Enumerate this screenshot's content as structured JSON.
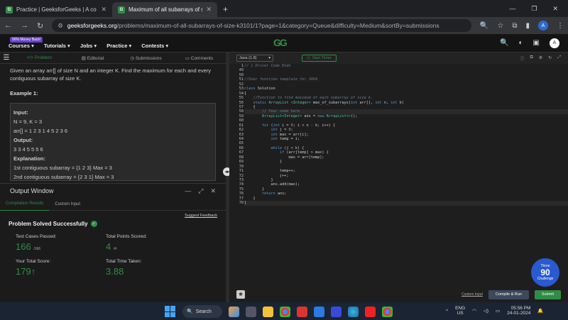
{
  "browser": {
    "tabs": [
      {
        "title": "Practice | GeeksforGeeks | A co"
      },
      {
        "title": "Maximum of all subarrays of siz"
      }
    ],
    "new_tab": "+",
    "window_controls": [
      "—",
      "❐",
      "✕"
    ],
    "url_host": "geeksforgeeks.org",
    "url_path": "/problems/maximum-of-all-subarrays-of-size-k3101/1?page=1&category=Queue&difficulty=Medium&sortBy=submissions",
    "profile_initial": "A"
  },
  "site": {
    "badge": "90% Money Back!",
    "menu": [
      "Courses ▾",
      "Tutorials ▾",
      "Jobs ▾",
      "Practice ▾",
      "Contests ▾"
    ],
    "logo": "GG",
    "profile_initial": "A"
  },
  "problem_tabs": [
    "Problem",
    "Editorial",
    "Submissions",
    "Comments"
  ],
  "problem": {
    "statement": "Given an array arr[] of size N and an integer K. Find the maximum for each and every contiguous subarray of size K.",
    "example_heading": "Example 1:",
    "example_lines": [
      {
        "t": "Input:",
        "bold": true
      },
      {
        "t": "N = 9, K = 3",
        "bold": false
      },
      {
        "t": "arr[] = 1 2 3 1 4 5 2 3 6",
        "bold": false
      },
      {
        "t": "Output:",
        "bold": true
      },
      {
        "t": "3 3 4 5 5 5 6",
        "bold": false
      },
      {
        "t": "Explanation:",
        "bold": true
      },
      {
        "t": "1st contiguous subarray = {1 2 3} Max = 3",
        "bold": false
      },
      {
        "t": "2nd contiguous subarray = {2 3 1} Max = 3",
        "bold": false
      }
    ]
  },
  "output_window": {
    "title": "Output Window",
    "controls": [
      "—",
      "⤢",
      "✕"
    ],
    "tabs": [
      "Compilation Results",
      "Custom Input"
    ],
    "suggest": "Suggest Feedback",
    "status": "Problem Solved Successfully",
    "stats": [
      {
        "label": "Test Cases Passed:",
        "value": "166",
        "sub": "/166"
      },
      {
        "label": "Total Points Scored:",
        "value": "4",
        "sub": "/4"
      },
      {
        "label": "Your Total Score:",
        "value": "179↑",
        "sub": ""
      },
      {
        "label": "Total Time Taken:",
        "value": "3.88",
        "sub": ""
      }
    ]
  },
  "editor": {
    "language": "Java (1.8)",
    "timer": "Start Timer",
    "bottom": {
      "custom_input": "Custom Input",
      "compile": "Compile & Run",
      "submit": "Submit"
    }
  },
  "code_lines": [
    {
      "n": "1",
      "html": "<span class='cm'>// } Driver Code Ends</span>"
    },
    {
      "n": "49",
      "html": ""
    },
    {
      "n": "50",
      "html": ""
    },
    {
      "n": "51",
      "html": "<span class='cm'>//User function template for JAVA</span>"
    },
    {
      "n": "52",
      "html": ""
    },
    {
      "n": "53",
      "html": "<span class='kw'>class</span> <span class='pl'>Solution</span>"
    },
    {
      "n": "54",
      "html": "<span class='op'>{</span>"
    },
    {
      "n": "55",
      "html": "    <span class='cm'>//Function to find maximum of each subarray of size k.</span>"
    },
    {
      "n": "56",
      "html": "    <span class='kw'>static</span> <span class='ty'>ArrayList</span> <span class='ty'>&lt;Integer&gt;</span> <span class='pl'>max_of_subarrays(</span><span class='kw'>int</span> <span class='pl'>arr[],</span> <span class='kw'>int</span> <span class='pl'>n,</span> <span class='kw'>int</span> <span class='pl'>k)</span>"
    },
    {
      "n": "57",
      "html": "    <span class='op'>{</span>"
    },
    {
      "n": "58",
      "html": "        <span class='cm'>// Your code here</span>",
      "cur": true
    },
    {
      "n": "59",
      "html": "        <span class='ty'>ArrayList&lt;Integer&gt;</span> <span class='pl'>ans =</span> <span class='kw'>new</span> <span class='ty'>ArrayList&lt;&gt;</span><span class='pl'>();</span>"
    },
    {
      "n": "60",
      "html": ""
    },
    {
      "n": "61",
      "html": "        <span class='kw'>for</span> <span class='pl'>(</span><span class='kw'>int</span> <span class='pl'>i =</span> <span class='nu'>0</span><span class='pl'>; i &lt; n - k; i++) {</span>"
    },
    {
      "n": "62",
      "html": "            <span class='kw'>int</span> <span class='pl'>j =</span> <span class='nu'>0</span><span class='pl'>;</span>"
    },
    {
      "n": "63",
      "html": "            <span class='kw'>int</span> <span class='pl'>max = arr[i];</span>"
    },
    {
      "n": "64",
      "html": "            <span class='kw'>int</span> <span class='pl'>temp = i;</span>"
    },
    {
      "n": "65",
      "html": ""
    },
    {
      "n": "66",
      "html": "            <span class='kw'>while</span> <span class='pl'>(j &lt; k) {</span>"
    },
    {
      "n": "67",
      "html": "                <span class='kw'>if</span> <span class='pl'>(arr[temp] &gt; max) {</span>"
    },
    {
      "n": "68",
      "html": "                    <span class='pl'>max = arr[temp];</span>"
    },
    {
      "n": "69",
      "html": "                <span class='pl'>}</span>"
    },
    {
      "n": "70",
      "html": ""
    },
    {
      "n": "71",
      "html": "                <span class='pl'>temp++;</span>"
    },
    {
      "n": "72",
      "html": "                <span class='pl'>j++;</span>"
    },
    {
      "n": "73",
      "html": "            <span class='pl'>}</span>"
    },
    {
      "n": "74",
      "html": "            <span class='pl'>ans.add(max);</span>"
    },
    {
      "n": "75",
      "html": "        <span class='pl'>}</span>"
    },
    {
      "n": "76",
      "html": "        <span class='kw'>return</span> <span class='pl'>ans;</span>"
    },
    {
      "n": "77",
      "html": "    <span class='pl'>}</span>"
    },
    {
      "n": "78",
      "html": "<span class='pl'>}</span>",
      "cur": true
    }
  ],
  "challenge": {
    "top": "Three",
    "num": "90",
    "bottom": "Challenge"
  },
  "taskbar": {
    "search": "Search",
    "lang_top": "ENG",
    "lang_bottom": "US",
    "time": "05:56 PM",
    "date": "24-01-2024"
  },
  "colors": {
    "accent": "#2f8d46",
    "background": "#1e1f22"
  }
}
